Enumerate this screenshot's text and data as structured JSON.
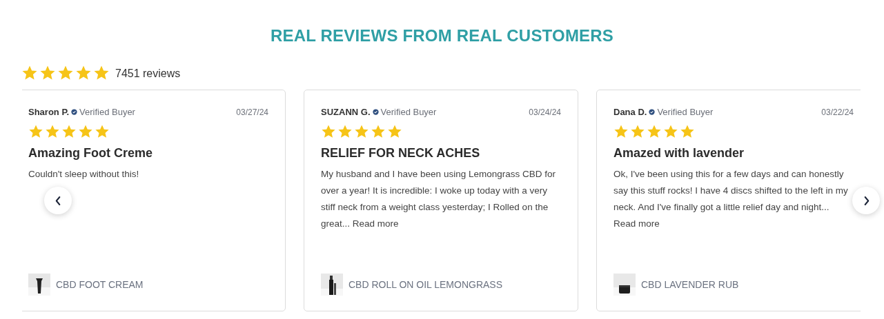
{
  "heading": "REAL REVIEWS FROM REAL CUSTOMERS",
  "summary": {
    "stars": 5,
    "count": "7451 reviews"
  },
  "reviews": [
    {
      "author": "Sharon P.",
      "verified": true,
      "badge": "Verified Buyer",
      "date": "03/27/24",
      "stars": 5,
      "title": "Amazing Foot Creme",
      "body": "Couldn't sleep without this!",
      "product": "CBD FOOT CREAM"
    },
    {
      "author": "SUZANN G.",
      "verified": true,
      "badge": "Verified Buyer",
      "date": "03/24/24",
      "stars": 5,
      "title": "RELIEF FOR NECK ACHES",
      "body": "My husband and I have been using Lemongrass CBD for over a year! It is incredible: I woke up today with a very stiff neck from a weight class yesterday; I Rolled on the great...",
      "link": "Read more",
      "product": "CBD ROLL ON OIL LEMONGRASS"
    },
    {
      "author": "Dana D.",
      "verified": true,
      "badge": "Verified Buyer",
      "date": "03/22/24",
      "stars": 5,
      "title": "Amazed with lavender",
      "body": "Ok, I've been using this for a few days and can honestly say this stuff rocks! I have 4 discs shifted to the left in my neck. And I've finally got a little relief day and night...",
      "link": "Read more",
      "product": "CBD LAVENDER RUB"
    }
  ]
}
